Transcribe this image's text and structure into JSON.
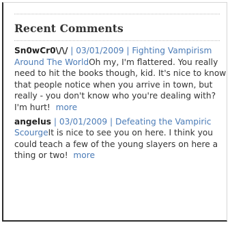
{
  "widget": {
    "title": "Recent Comments"
  },
  "comments": [
    {
      "author": "Sn0wCr0\\/\\/",
      "separator": " | ",
      "date": "03/01/2009 |",
      "post_link": "Fighting Vampirism Around The World",
      "text": "Oh my, I'm flattered. You really need to hit the books though, kid. It's nice to know that people notice when you arrive in town, but really - you don't know who you're dealing with? I'm hurt!",
      "more": "more"
    },
    {
      "author": "angelus",
      "separator": " | ",
      "date": "03/01/2009 |",
      "post_link": "Defeating the Vampiric Scourge",
      "text": "It is nice to see you on here. I think you could teach a few of the young slayers on here a thing or two!",
      "more": "more"
    }
  ],
  "colors": {
    "link": "#4a7bb7",
    "text": "#333333",
    "author": "#222222"
  }
}
